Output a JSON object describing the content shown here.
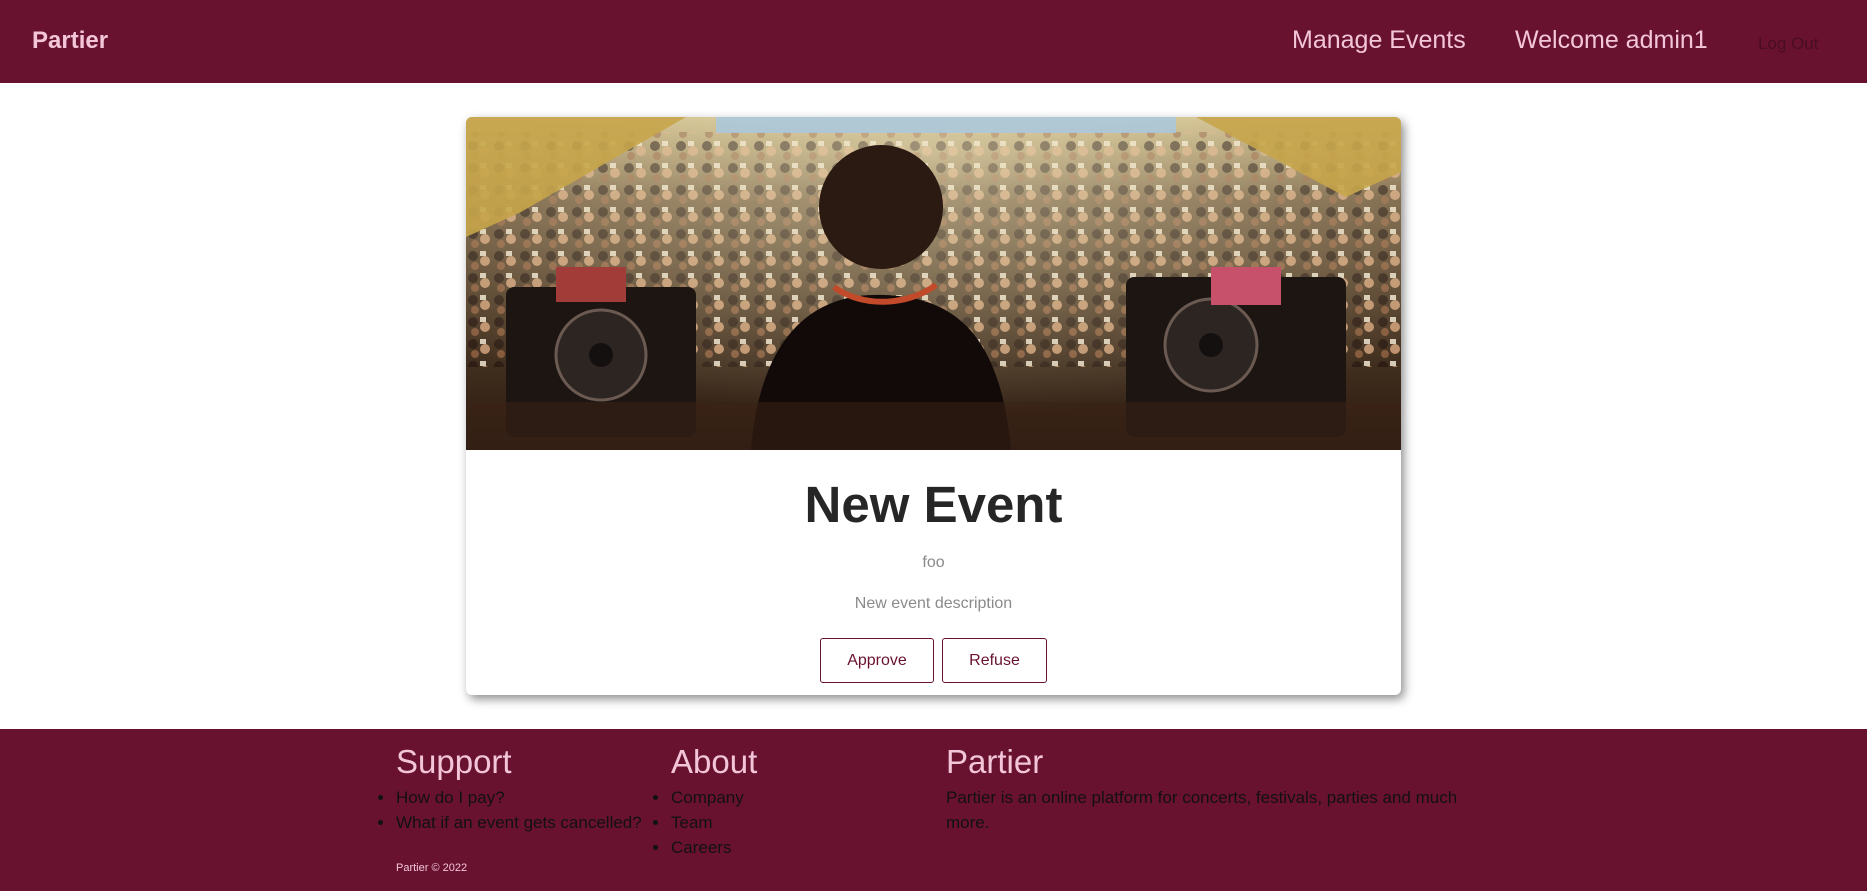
{
  "navbar": {
    "brand": "Partier",
    "links": [
      "Manage Events",
      "Welcome admin1"
    ],
    "logout": "Log Out"
  },
  "event": {
    "title": "New Event",
    "subtitle": "foo",
    "description": "New event description",
    "approve_label": "Approve",
    "refuse_label": "Refuse"
  },
  "footer": {
    "support": {
      "heading": "Support",
      "items": [
        "How do I pay?",
        "What if an event gets cancelled?"
      ]
    },
    "about": {
      "heading": "About",
      "items": [
        "Company",
        "Team",
        "Careers"
      ]
    },
    "partier": {
      "heading": "Partier",
      "text": "Partier is an online platform for concerts, festivals, parties and much more."
    },
    "copyright": "Partier © 2022"
  },
  "colors": {
    "brand": "#691230",
    "brand_light": "#f2c6d8"
  }
}
